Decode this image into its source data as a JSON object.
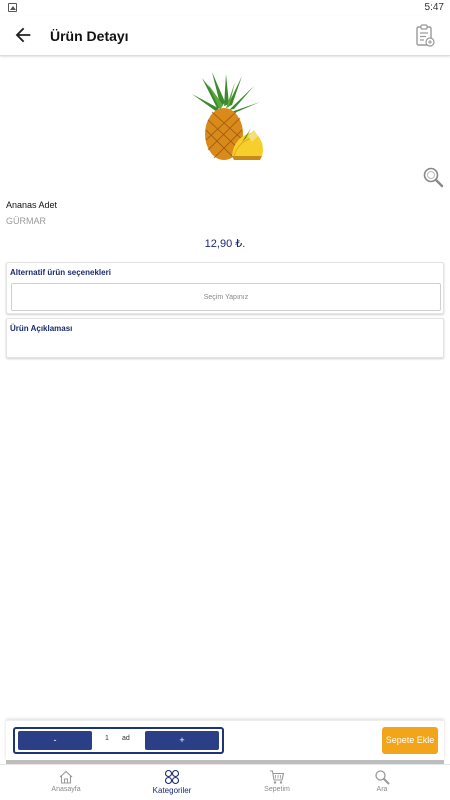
{
  "status_bar": {
    "time": "5:47"
  },
  "header": {
    "title": "Ürün Detayı"
  },
  "product": {
    "name": "Ananas Adet",
    "brand": "GÜRMAR",
    "price": "12,90 ₺."
  },
  "alternatives": {
    "title": "Alternatif ürün seçenekleri",
    "placeholder": "Seçim Yapınız"
  },
  "description": {
    "title": "Ürün Açıklaması"
  },
  "cart": {
    "minus_label": "-",
    "quantity": "1",
    "unit": "ad",
    "plus_label": "+",
    "add_label": "Sepete Ekle"
  },
  "bottom_nav": {
    "items": [
      {
        "label": "Anasayfa",
        "icon": "home-icon"
      },
      {
        "label": "Kategoriler",
        "icon": "grid-icon",
        "active": true
      },
      {
        "label": "Sepetim",
        "icon": "cart-icon"
      },
      {
        "label": "Ara",
        "icon": "search-icon"
      }
    ]
  },
  "colors": {
    "accent": "#1c2a6e",
    "button_blue": "#2a3f86",
    "add_to_cart": "#f2a51a"
  }
}
